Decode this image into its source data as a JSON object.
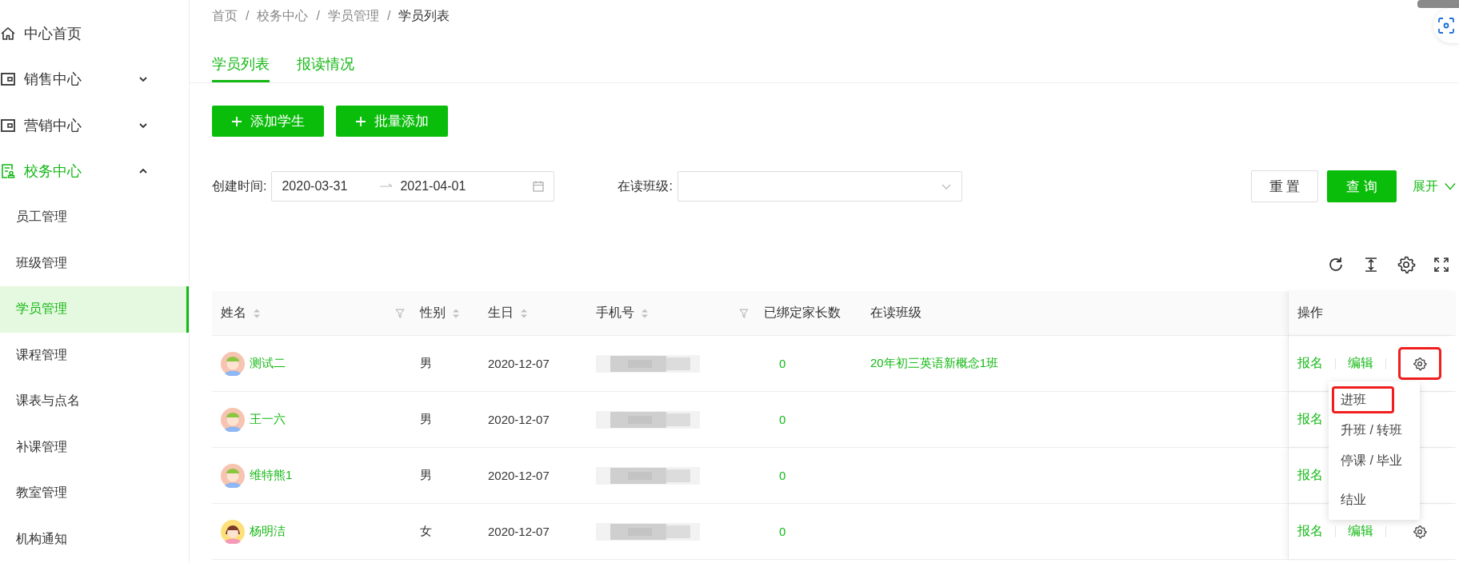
{
  "sidebar": {
    "items": [
      {
        "label": "中心首页",
        "kind": "home",
        "selected": false
      },
      {
        "label": "销售中心",
        "kind": "wallet",
        "expanded": false,
        "selected": false
      },
      {
        "label": "营销中心",
        "kind": "wallet",
        "expanded": false,
        "selected": false
      },
      {
        "label": "校务中心",
        "kind": "school",
        "expanded": true,
        "selected": true,
        "children": [
          {
            "label": "员工管理",
            "selected": false
          },
          {
            "label": "班级管理",
            "selected": false
          },
          {
            "label": "学员管理",
            "selected": true
          },
          {
            "label": "课程管理",
            "selected": false
          },
          {
            "label": "课表与点名",
            "selected": false
          },
          {
            "label": "补课管理",
            "selected": false
          },
          {
            "label": "教室管理",
            "selected": false
          },
          {
            "label": "机构通知",
            "selected": false
          }
        ]
      }
    ]
  },
  "breadcrumb": {
    "separator": "/",
    "items": [
      "首页",
      "校务中心",
      "学员管理",
      "学员列表"
    ]
  },
  "tabs": [
    {
      "label": "学员列表",
      "selected": true
    },
    {
      "label": "报读情况",
      "selected": false
    }
  ],
  "actions": [
    "添加学生",
    "批量添加"
  ],
  "filters": {
    "created": {
      "label": "创建时间:",
      "start": "2020-03-31",
      "end": "2021-04-01"
    },
    "class": {
      "label": "在读班级:"
    }
  },
  "buttons": {
    "reset": "重 置",
    "search": "查 询",
    "expand": "展开"
  },
  "table": {
    "columns": [
      {
        "label": "姓名",
        "sortable": true,
        "filter": true
      },
      {
        "label": "性别",
        "sortable": true,
        "filter": false
      },
      {
        "label": "生日",
        "sortable": true,
        "filter": false
      },
      {
        "label": "手机号",
        "sortable": true,
        "filter": true
      },
      {
        "label": "已绑定家长数",
        "sortable": false,
        "filter": false
      },
      {
        "label": "在读班级",
        "sortable": false,
        "filter": false
      },
      {
        "label": "操作",
        "sortable": false,
        "filter": false
      }
    ],
    "rows": [
      {
        "name": "测试二",
        "kind": "boy",
        "gender": "男",
        "birthday": "2020-12-07",
        "parents": "0",
        "class": "20年初三英语新概念1班",
        "actions": [
          "报名",
          "编辑"
        ],
        "gear": {
          "highlighted": true
        }
      },
      {
        "name": "王一六",
        "kind": "boy",
        "gender": "男",
        "birthday": "2020-12-07",
        "parents": "0",
        "actions": [
          "报名"
        ]
      },
      {
        "name": "维特熊1",
        "kind": "boy",
        "gender": "男",
        "birthday": "2020-12-07",
        "parents": "0",
        "actions": [
          "报名"
        ]
      },
      {
        "name": "杨明洁",
        "kind": "girl",
        "gender": "女",
        "birthday": "2020-12-07",
        "parents": "0",
        "actions": [
          "报名",
          "编辑"
        ],
        "gear": {
          "highlighted": false
        }
      }
    ]
  },
  "row_menu": {
    "items": [
      {
        "label": "进班",
        "highlighted": true
      },
      {
        "label": "升班 / 转班",
        "highlighted": false
      },
      {
        "label": "停课 / 毕业",
        "highlighted": false
      },
      {
        "label": "结业",
        "highlighted": false
      }
    ]
  }
}
